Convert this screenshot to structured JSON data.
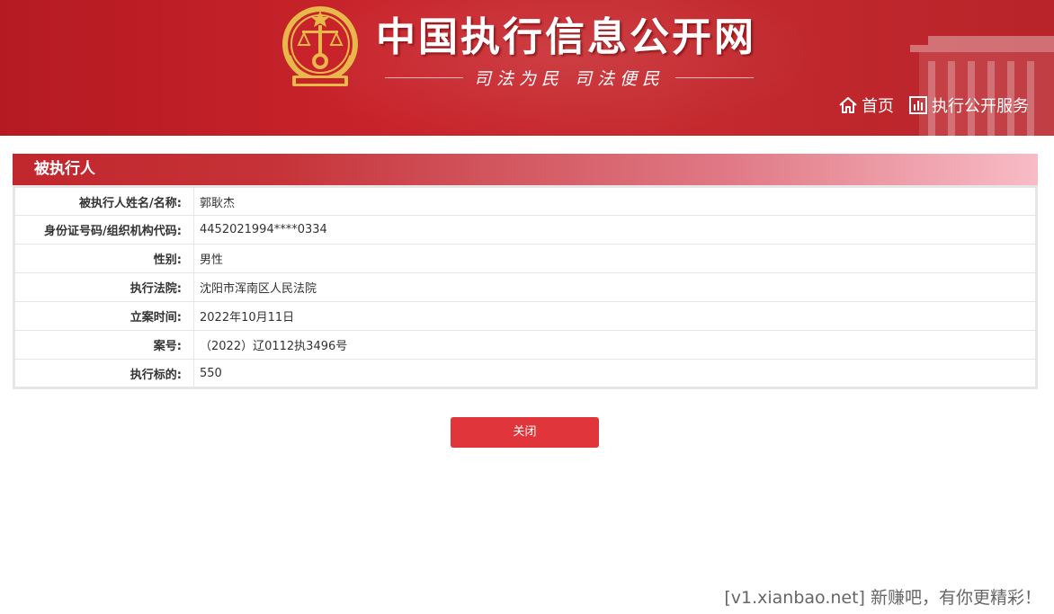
{
  "header": {
    "site_title": "中国执行信息公开网",
    "slogan": "司法为民  司法便民",
    "nav": {
      "home_label": "首页",
      "service_label": "执行公开服务"
    }
  },
  "panel": {
    "title": "被执行人",
    "rows": [
      {
        "label": "被执行人姓名/名称:",
        "value": "郭耿杰"
      },
      {
        "label": "身份证号码/组织机构代码:",
        "value": "4452021994****0334"
      },
      {
        "label": "性别:",
        "value": "男性"
      },
      {
        "label": "执行法院:",
        "value": "沈阳市浑南区人民法院"
      },
      {
        "label": "立案时间:",
        "value": "2022年10月11日"
      },
      {
        "label": "案号:",
        "value": "（2022）辽0112执3496号"
      },
      {
        "label": "执行标的:",
        "value": "550"
      }
    ]
  },
  "close_button_label": "关闭",
  "watermark": "[v1.xianbao.net] 新赚吧，有你更精彩！",
  "colors": {
    "header_red": "#c8232b",
    "button_red": "#e0353b",
    "emblem_gold": "#e9b84a"
  }
}
